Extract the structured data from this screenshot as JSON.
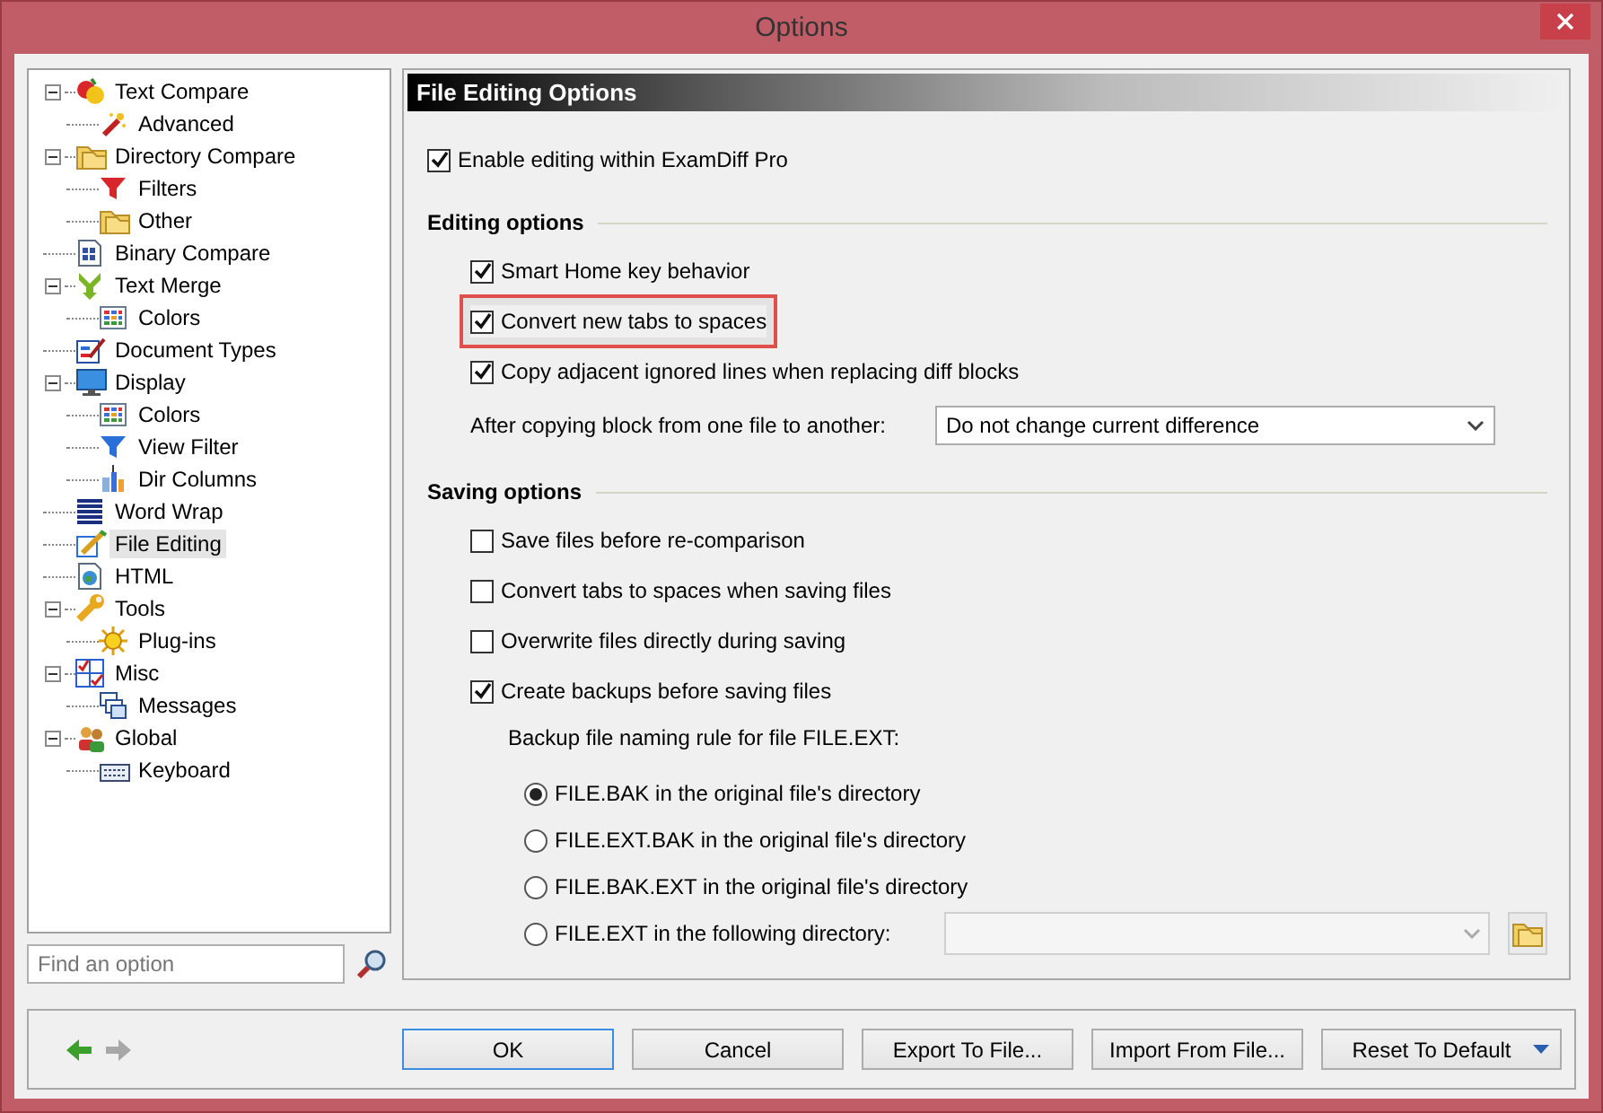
{
  "window": {
    "title": "Options"
  },
  "tree": [
    {
      "label": "Text Compare",
      "expanded": true,
      "selected": false,
      "children": [
        {
          "label": "Advanced",
          "selected": false
        }
      ]
    },
    {
      "label": "Directory Compare",
      "expanded": true,
      "selected": false,
      "children": [
        {
          "label": "Filters",
          "selected": false
        },
        {
          "label": "Other",
          "selected": false
        }
      ]
    },
    {
      "label": "Binary Compare",
      "selected": false
    },
    {
      "label": "Text Merge",
      "expanded": true,
      "selected": false,
      "children": [
        {
          "label": "Colors",
          "selected": false
        }
      ]
    },
    {
      "label": "Document Types",
      "selected": false
    },
    {
      "label": "Display",
      "expanded": true,
      "selected": false,
      "children": [
        {
          "label": "Colors",
          "selected": false
        },
        {
          "label": "View Filter",
          "selected": false
        },
        {
          "label": "Dir Columns",
          "selected": false
        }
      ]
    },
    {
      "label": "Word Wrap",
      "selected": false
    },
    {
      "label": "File Editing",
      "selected": true
    },
    {
      "label": "HTML",
      "selected": false
    },
    {
      "label": "Tools",
      "expanded": true,
      "selected": false,
      "children": [
        {
          "label": "Plug-ins",
          "selected": false
        }
      ]
    },
    {
      "label": "Misc",
      "expanded": true,
      "selected": false,
      "children": [
        {
          "label": "Messages",
          "selected": false
        }
      ]
    },
    {
      "label": "Global",
      "expanded": true,
      "selected": false,
      "children": [
        {
          "label": "Keyboard",
          "selected": false
        }
      ]
    }
  ],
  "search": {
    "placeholder": "Find an option"
  },
  "panel": {
    "title": "File Editing Options",
    "enable": {
      "label": "Enable editing within ExamDiff Pro",
      "checked": true
    },
    "sections": [
      {
        "title": "Editing options",
        "items": [
          {
            "kind": "checkbox",
            "label": "Smart Home key behavior",
            "checked": true,
            "highlighted": false
          },
          {
            "kind": "checkbox",
            "label": "Convert new tabs to spaces",
            "checked": true,
            "highlighted": true
          },
          {
            "kind": "checkbox",
            "label": "Copy adjacent ignored lines when replacing diff blocks",
            "checked": true,
            "highlighted": false
          },
          {
            "kind": "dropdown",
            "label": "After copying block from one file to another:",
            "value": "Do not change current difference"
          }
        ]
      },
      {
        "title": "Saving options",
        "items": [
          {
            "kind": "checkbox",
            "label": "Save files before re-comparison",
            "checked": false,
            "highlighted": false
          },
          {
            "kind": "checkbox",
            "label": "Convert tabs to spaces when saving files",
            "checked": false,
            "highlighted": false
          },
          {
            "kind": "checkbox",
            "label": "Overwrite files directly during saving",
            "checked": false,
            "highlighted": false
          },
          {
            "kind": "checkbox",
            "label": "Create backups before saving files",
            "checked": true,
            "highlighted": false
          },
          {
            "kind": "label",
            "label": "Backup file naming rule for file FILE.EXT:"
          },
          {
            "kind": "radio",
            "label": "FILE.BAK in the original file's directory",
            "selected": true
          },
          {
            "kind": "radio",
            "label": "FILE.EXT.BAK in the original file's directory",
            "selected": false
          },
          {
            "kind": "radio",
            "label": "FILE.BAK.EXT in the original file's directory",
            "selected": false
          },
          {
            "kind": "directory",
            "label": "FILE.EXT in the following directory:",
            "selected": false,
            "disabled": true
          }
        ]
      }
    ]
  },
  "nav": {
    "back_disabled": false,
    "forward_disabled": true
  },
  "buttons": [
    {
      "kind": "push",
      "label": "OK",
      "default": true
    },
    {
      "kind": "push",
      "label": "Cancel",
      "default": false
    },
    {
      "kind": "push",
      "label": "Export To File...",
      "default": false
    },
    {
      "kind": "push",
      "label": "Import From File...",
      "default": false
    },
    {
      "kind": "split",
      "label": "Reset To Default",
      "default": false
    }
  ]
}
